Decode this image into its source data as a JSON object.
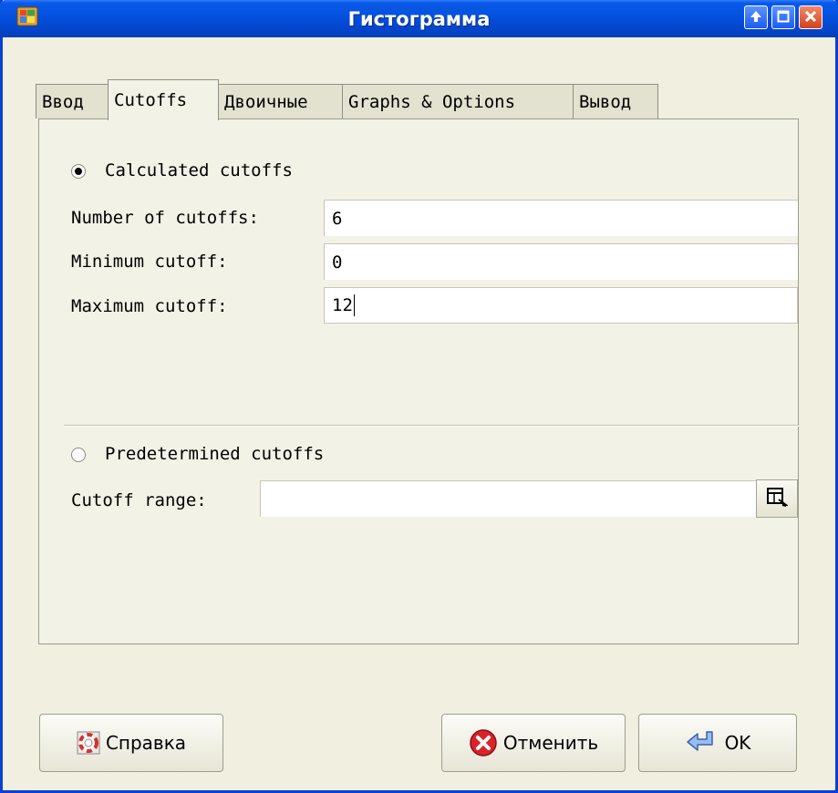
{
  "window": {
    "title": "Гистограмма",
    "titlebar_color": "#0551e0",
    "buttons": [
      "roll-up-icon",
      "maximize-icon",
      "close-icon"
    ]
  },
  "tabs": [
    {
      "label": "Ввод",
      "active": false
    },
    {
      "label": "Cutoffs",
      "active": true
    },
    {
      "label": "Двоичные",
      "active": false
    },
    {
      "label": "Graphs & Options",
      "active": false
    },
    {
      "label": "Вывод",
      "active": false
    }
  ],
  "calculated": {
    "radio_label": "Calculated cutoffs",
    "selected": true,
    "fields": [
      {
        "label": "Number of cutoffs:",
        "value": "6"
      },
      {
        "label": "Minimum cutoff:",
        "value": "0"
      },
      {
        "label": "Maximum cutoff:",
        "value": "12"
      }
    ]
  },
  "predetermined": {
    "radio_label": "Predetermined cutoffs",
    "selected": false,
    "range_label": "Cutoff range:",
    "range_value": ""
  },
  "footer": {
    "help_label": "Справка",
    "cancel_label": "Отменить",
    "ok_label": "OK"
  }
}
